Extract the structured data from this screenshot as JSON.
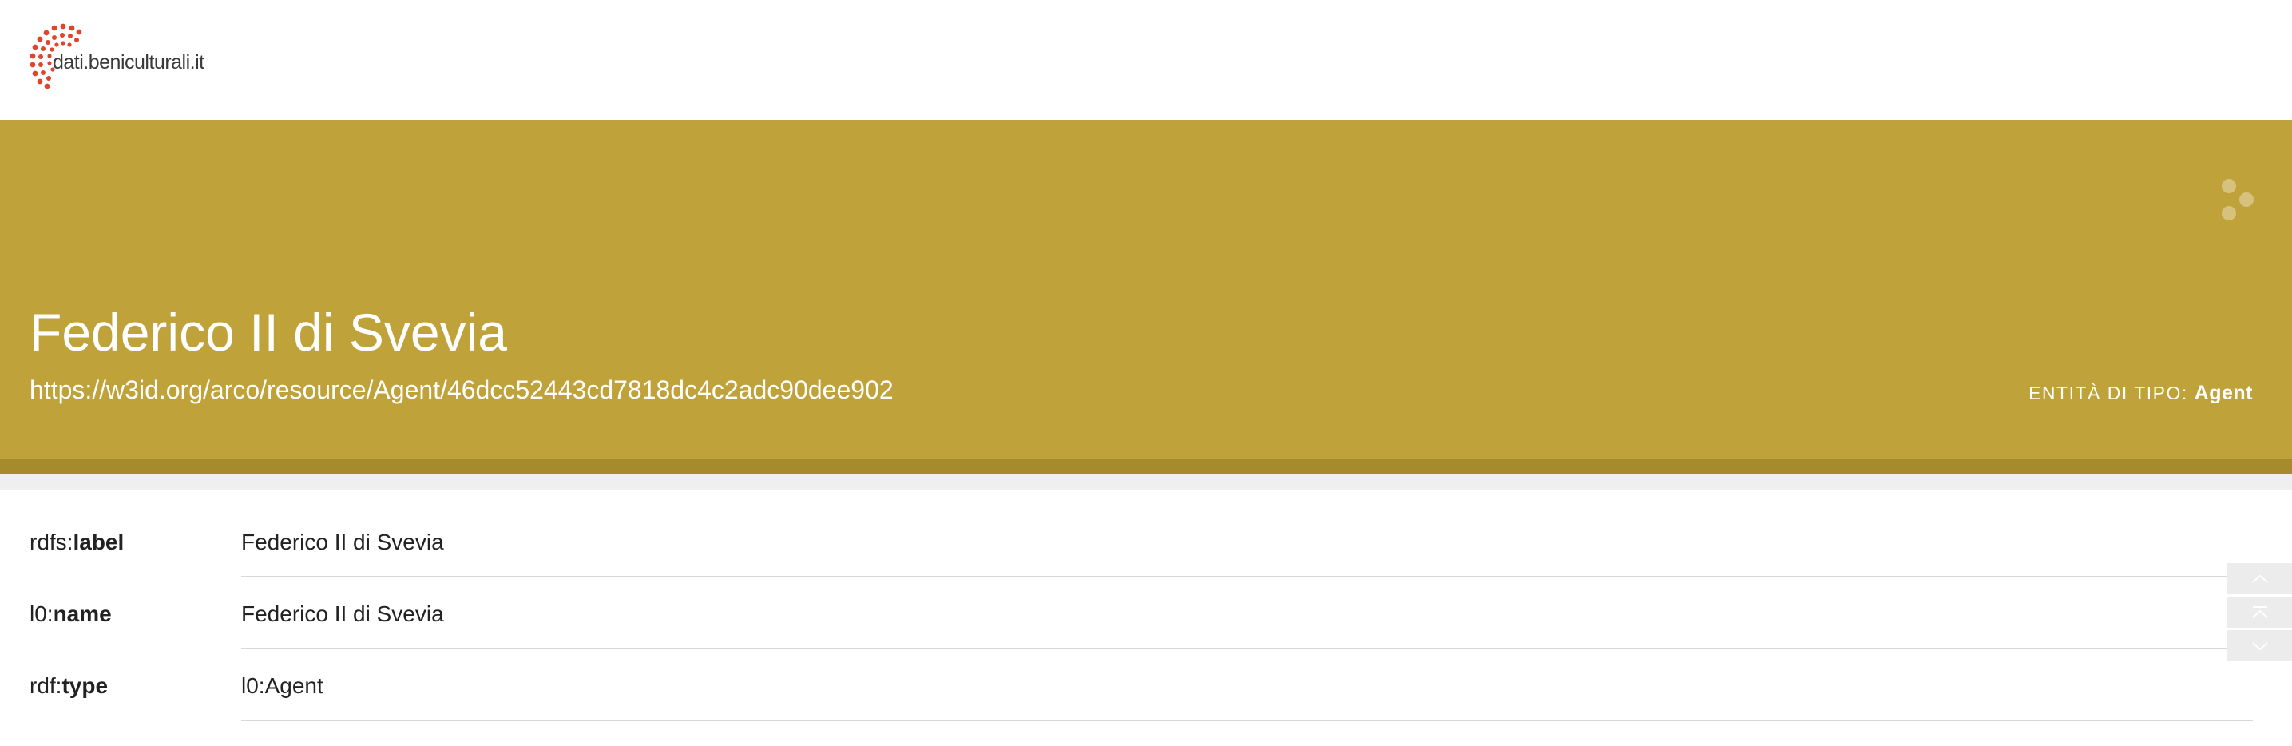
{
  "header": {
    "logo_text": "dati.beniculturali.it"
  },
  "hero": {
    "title": "Federico II di Svevia",
    "uri": "https://w3id.org/arco/resource/Agent/46dcc52443cd7818dc4c2adc90dee902",
    "entity_type_label": "ENTITÀ DI TIPO:",
    "entity_type_value": "Agent"
  },
  "properties": [
    {
      "prefix": "rdfs:",
      "local": "label",
      "value": "Federico II di Svevia"
    },
    {
      "prefix": "l0:",
      "local": "name",
      "value": "Federico II di Svevia"
    },
    {
      "prefix": "rdf:",
      "local": "type",
      "value": "l0:Agent"
    }
  ],
  "colors": {
    "hero_bg": "#bfa23a",
    "hero_bottom_bar": "#a68b2c",
    "logo_dots": "#e0452c"
  },
  "icons": {
    "share": "share-icon",
    "scroll_up": "chevron-up-icon",
    "scroll_top": "double-chevron-up-icon",
    "scroll_down": "chevron-down-icon"
  }
}
